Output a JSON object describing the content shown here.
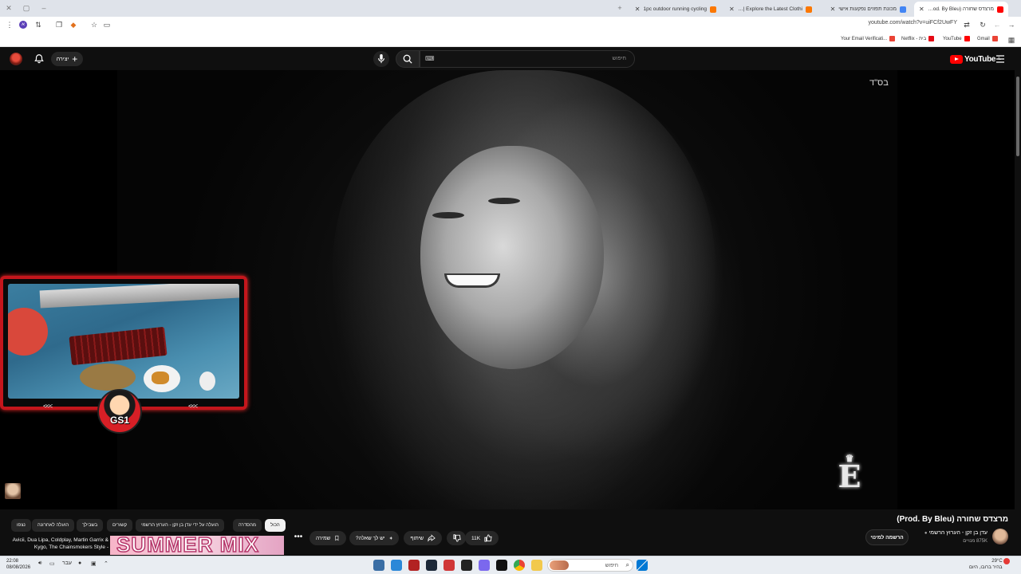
{
  "browser": {
    "tabs": [
      {
        "label": "מרצדס שחורה (Prod. By Bleu)",
        "active": true,
        "favicon_color": "#ff0000"
      },
      {
        "label": "מכונת תפוזים נפקעות אישי",
        "active": false,
        "favicon_color": "#4285f4"
      },
      {
        "label": "Temu | Explore the Latest Clothi",
        "active": false,
        "favicon_color": "#fb7701"
      },
      {
        "label": "1pc outdoor running cycling",
        "active": false,
        "favicon_color": "#fb7701"
      }
    ],
    "url": "youtube.com/watch?v=uiFCf2UwFY",
    "bookmarks": [
      {
        "label": "Gmail",
        "favicon_color": "#ea4335"
      },
      {
        "label": "YouTube",
        "favicon_color": "#ff0000"
      },
      {
        "label": "Netflix - בית",
        "favicon_color": "#e50914"
      },
      {
        "label": "Your Email Verificati...",
        "favicon_color": "#ea4335"
      }
    ]
  },
  "youtube": {
    "logo_text": "YouTube",
    "logo_sup": "IL",
    "search_placeholder": "חיפוש",
    "create_label": "יצירה",
    "video_overlay_text": "בס\"ד",
    "crest_letter": "E",
    "webcam_label": "GS1",
    "webcam_arrows_left": "<<<",
    "webcam_arrows_right": "<<<",
    "video": {
      "title": "מרצדס שחורה (Prod. By Bleu)",
      "channel": "עדן בן זקן - הערוץ הרשמי",
      "subscribers": "875K מנויים",
      "subscribe_label": "הרשמה למינוי",
      "likes": "11K",
      "share_label": "שיתוף",
      "ask_label": "יש לך שאלה?",
      "save_label": "שמירה"
    },
    "chips": [
      {
        "label": "הכול",
        "active": true
      },
      {
        "label": "מהסדרה",
        "active": false
      },
      {
        "label": "הועלה על ידי עדן בן זקן - הערוץ הרשמי",
        "active": false
      },
      {
        "label": "קשורים",
        "active": false
      },
      {
        "label": "בשבילך",
        "active": false
      },
      {
        "label": "הועלה לאחרונה",
        "active": false
      },
      {
        "label": "נצפו",
        "active": false
      }
    ],
    "recommendation": {
      "title": "Avicii, Dua Lipa, Coldplay, Martin Garrix & Kygo, The Chainsmokers Style -",
      "thumb_text": "SUMMER MIX"
    }
  },
  "taskbar": {
    "time": "22:08",
    "date": "08/08/2026",
    "lang": "עבר",
    "search_placeholder": "חיפוש",
    "weather_temp": "29°C",
    "weather_desc": "בהיר ברובו, היום"
  },
  "colors": {
    "yt_red": "#ff0000",
    "webcam_frame": "#c4161c",
    "page_bg": "#0f0f0f"
  }
}
